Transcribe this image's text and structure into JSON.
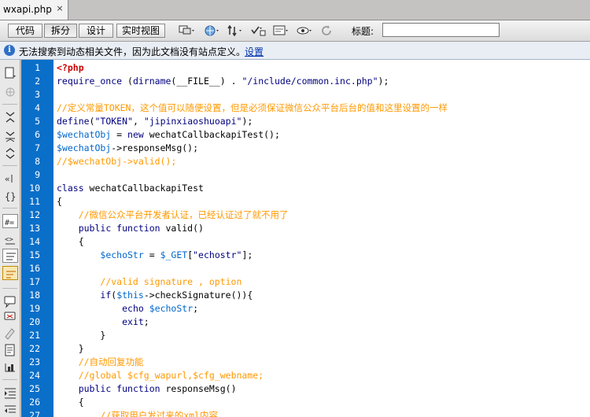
{
  "document_tab": {
    "name": "wxapi.php",
    "close_glyph": "×"
  },
  "toolbar": {
    "view_buttons": [
      "代码",
      "拆分",
      "设计",
      "实时视图"
    ],
    "title_label": "标题:",
    "title_value": ""
  },
  "infobar": {
    "message": "无法搜索到动态相关文件，因为此文档没有站点定义。",
    "link": "设置"
  },
  "colors": {
    "gutter": "#0a6fc9",
    "keyword": "#000080",
    "variable": "#0066cc",
    "comment": "#ff9900",
    "php_tag": "#cc0000"
  },
  "left_toolbar_icons": [
    "open-documents-icon",
    "code-navigator-icon",
    "collapse-tag-icon",
    "collapse-selection-icon",
    "expand-all-icon",
    "select-parent-tag-icon",
    "balance-braces-icon",
    "line-numbers-icon",
    "highlight-invalid-code-icon",
    "word-wrap-icon",
    "syntax-coloring-icon",
    "apply-comment-icon",
    "remove-comment-icon",
    "wrap-tag-icon",
    "recent-snippets-icon",
    "move-css-icon",
    "indent-code-icon",
    "outdent-code-icon"
  ],
  "code": {
    "line_numbers": [
      "1",
      "2",
      "3",
      "4",
      "5",
      "6",
      "7",
      "8",
      "9",
      "10",
      "11",
      "12",
      "13",
      "14",
      "15",
      "16",
      "17",
      "18",
      "19",
      "20",
      "21",
      "22",
      "23",
      "24",
      "25",
      "26",
      "27"
    ],
    "lines": [
      [
        [
          "tag",
          "<?php"
        ]
      ],
      [
        [
          "kw",
          "require_once"
        ],
        [
          "plain",
          " ("
        ],
        [
          "kw",
          "dirname"
        ],
        [
          "plain",
          "(__FILE__) . "
        ],
        [
          "str",
          "\"/include/common.inc.php\""
        ],
        [
          "plain",
          ");"
        ]
      ],
      [],
      [
        [
          "cmt",
          "//定义常量TOKEN，这个值可以随便设置，但是必须保证微信公众平台后台的值和这里设置的一样"
        ]
      ],
      [
        [
          "kw",
          "define"
        ],
        [
          "plain",
          "("
        ],
        [
          "str",
          "\"TOKEN\""
        ],
        [
          "plain",
          ", "
        ],
        [
          "str",
          "\"jipinxiaoshuoapi\""
        ],
        [
          "plain",
          ");"
        ]
      ],
      [
        [
          "var",
          "$wechatObj"
        ],
        [
          "plain",
          " = "
        ],
        [
          "kw",
          "new"
        ],
        [
          "plain",
          " wechatCallbackapiTest();"
        ]
      ],
      [
        [
          "var",
          "$wechatObj"
        ],
        [
          "plain",
          "->responseMsg();"
        ]
      ],
      [
        [
          "cmt",
          "//$wechatObj->valid();"
        ]
      ],
      [],
      [
        [
          "kw",
          "class"
        ],
        [
          "plain",
          " wechatCallbackapiTest"
        ]
      ],
      [
        [
          "plain",
          "{"
        ]
      ],
      [
        [
          "plain",
          "    "
        ],
        [
          "cmt",
          "//微信公众平台开发者认证，已经认证过了就不用了"
        ]
      ],
      [
        [
          "plain",
          "    "
        ],
        [
          "kw",
          "public function"
        ],
        [
          "plain",
          " valid()"
        ]
      ],
      [
        [
          "plain",
          "    {"
        ]
      ],
      [
        [
          "plain",
          "        "
        ],
        [
          "var",
          "$echoStr"
        ],
        [
          "plain",
          " = "
        ],
        [
          "var",
          "$_GET"
        ],
        [
          "plain",
          "["
        ],
        [
          "str",
          "\"echostr\""
        ],
        [
          "plain",
          "];"
        ]
      ],
      [],
      [
        [
          "plain",
          "        "
        ],
        [
          "cmt",
          "//valid signature , option"
        ]
      ],
      [
        [
          "plain",
          "        "
        ],
        [
          "kw",
          "if"
        ],
        [
          "plain",
          "("
        ],
        [
          "var",
          "$this"
        ],
        [
          "plain",
          "->checkSignature()){"
        ]
      ],
      [
        [
          "plain",
          "            "
        ],
        [
          "kw",
          "echo"
        ],
        [
          "plain",
          " "
        ],
        [
          "var",
          "$echoStr"
        ],
        [
          "plain",
          ";"
        ]
      ],
      [
        [
          "plain",
          "            "
        ],
        [
          "kw",
          "exit"
        ],
        [
          "plain",
          ";"
        ]
      ],
      [
        [
          "plain",
          "        }"
        ]
      ],
      [
        [
          "plain",
          "    }"
        ]
      ],
      [
        [
          "plain",
          "    "
        ],
        [
          "cmt",
          "//自动回复功能"
        ]
      ],
      [
        [
          "plain",
          "    "
        ],
        [
          "cmt",
          "//global $cfg_wapurl,$cfg_webname;"
        ]
      ],
      [
        [
          "plain",
          "    "
        ],
        [
          "kw",
          "public function"
        ],
        [
          "plain",
          " responseMsg()"
        ]
      ],
      [
        [
          "plain",
          "    {"
        ]
      ],
      [
        [
          "plain",
          "        "
        ],
        [
          "cmt",
          "//获取用户发过来的xml内容"
        ]
      ]
    ]
  }
}
